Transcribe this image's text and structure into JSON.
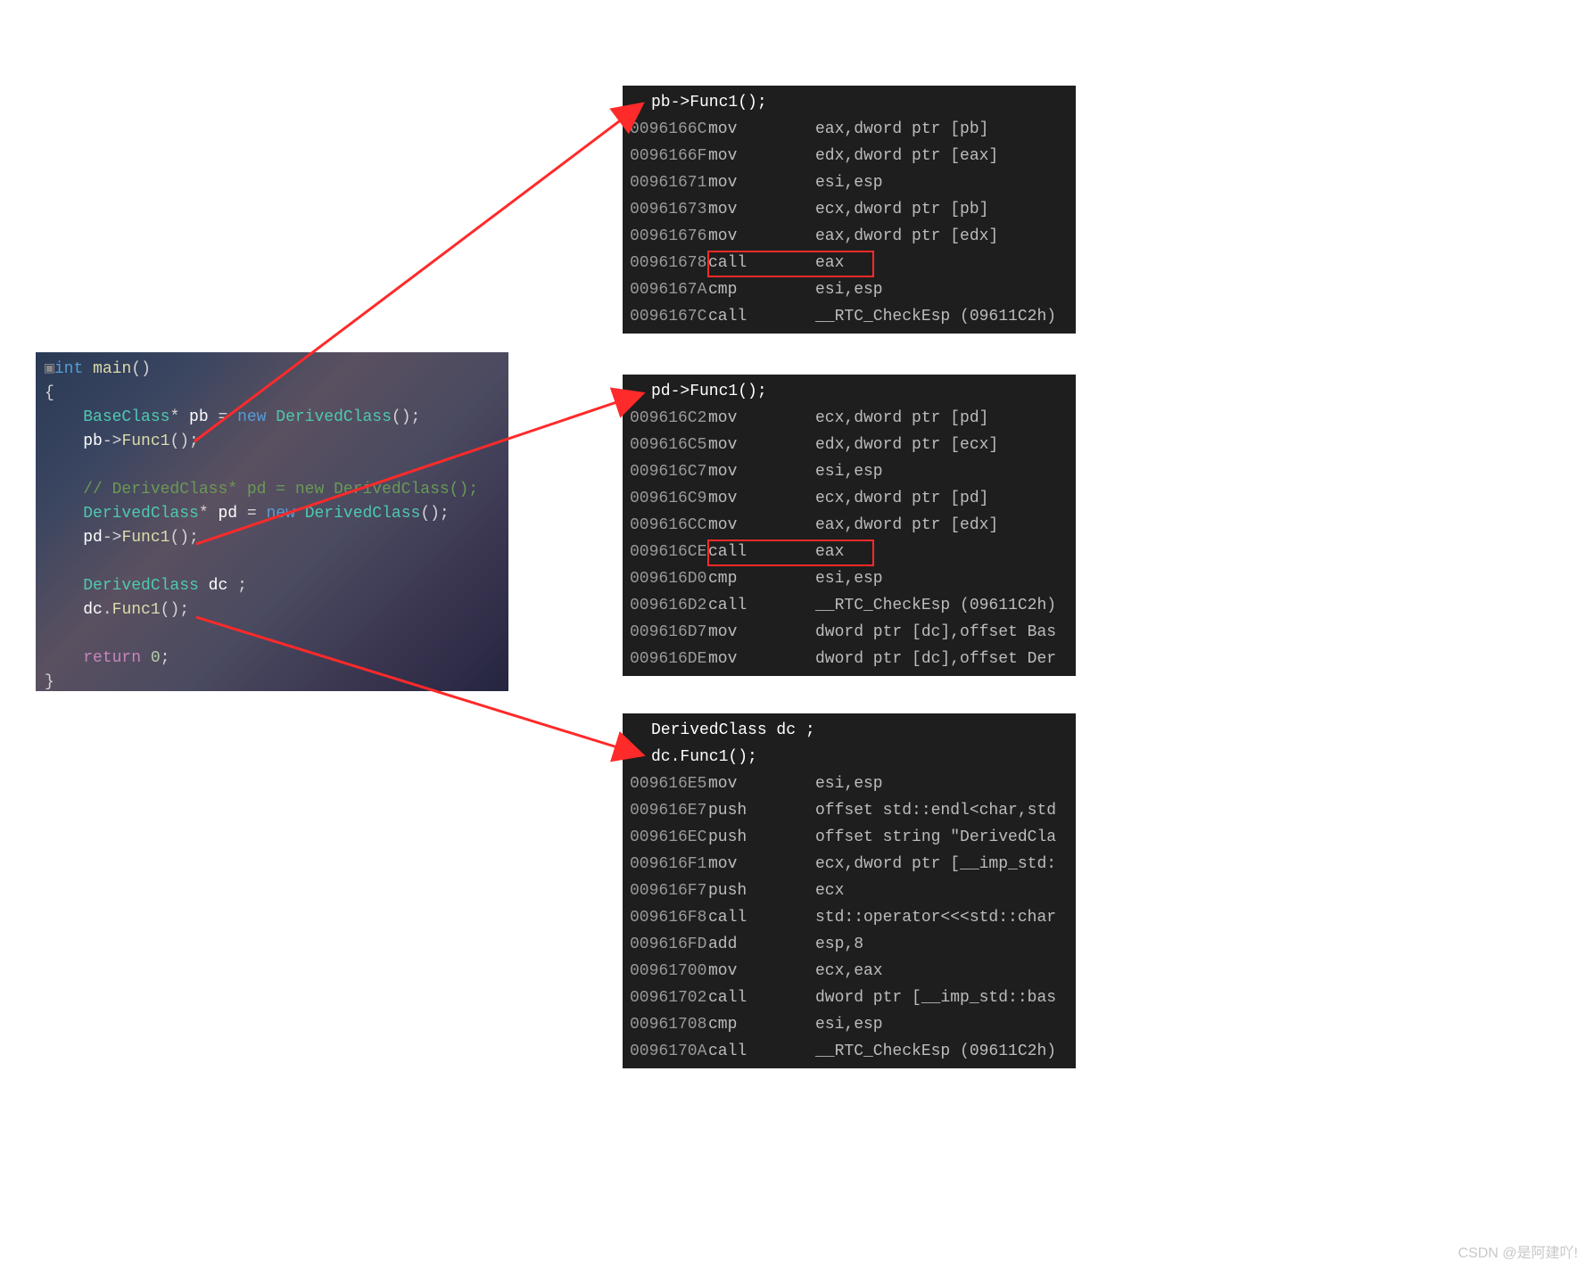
{
  "source": {
    "fn_sig_type": "int",
    "fn_sig_name": "main",
    "line_base_decl_a": "BaseClass",
    "line_base_decl_b": "pb",
    "line_base_decl_c": "new",
    "line_base_decl_d": "DerivedClass",
    "line_pb_call_obj": "pb",
    "line_pb_call_fn": "Func1",
    "line_cmt": "// DerivedClass* pd = new DerivedClass();",
    "line_pd_decl_a": "DerivedClass",
    "line_pd_decl_b": "pd",
    "line_pd_decl_c": "new",
    "line_pd_decl_d": "DerivedClass",
    "line_pd_call_obj": "pd",
    "line_pd_call_fn": "Func1",
    "line_dc_decl_a": "DerivedClass",
    "line_dc_decl_b": "dc",
    "line_dc_call_obj": "dc",
    "line_dc_call_fn": "Func1",
    "line_ret_kw": "return",
    "line_ret_val": "0"
  },
  "asm1": {
    "header": "pb->Func1();",
    "rows": [
      {
        "addr": "0096166C",
        "mnem": "mov",
        "oper": "eax,dword ptr [pb]"
      },
      {
        "addr": "0096166F",
        "mnem": "mov",
        "oper": "edx,dword ptr [eax]"
      },
      {
        "addr": "00961671",
        "mnem": "mov",
        "oper": "esi,esp"
      },
      {
        "addr": "00961673",
        "mnem": "mov",
        "oper": "ecx,dword ptr [pb]"
      },
      {
        "addr": "00961676",
        "mnem": "mov",
        "oper": "eax,dword ptr [edx]"
      },
      {
        "addr": "00961678",
        "mnem": "call",
        "oper": "eax"
      },
      {
        "addr": "0096167A",
        "mnem": "cmp",
        "oper": "esi,esp"
      },
      {
        "addr": "0096167C",
        "mnem": "call",
        "oper": "__RTC_CheckEsp (09611C2h)"
      }
    ]
  },
  "asm2": {
    "header": "pd->Func1();",
    "rows": [
      {
        "addr": "009616C2",
        "mnem": "mov",
        "oper": "ecx,dword ptr [pd]"
      },
      {
        "addr": "009616C5",
        "mnem": "mov",
        "oper": "edx,dword ptr [ecx]"
      },
      {
        "addr": "009616C7",
        "mnem": "mov",
        "oper": "esi,esp"
      },
      {
        "addr": "009616C9",
        "mnem": "mov",
        "oper": "ecx,dword ptr [pd]"
      },
      {
        "addr": "009616CC",
        "mnem": "mov",
        "oper": "eax,dword ptr [edx]"
      },
      {
        "addr": "009616CE",
        "mnem": "call",
        "oper": "eax"
      },
      {
        "addr": "009616D0",
        "mnem": "cmp",
        "oper": "esi,esp"
      },
      {
        "addr": "009616D2",
        "mnem": "call",
        "oper": "__RTC_CheckEsp (09611C2h)"
      },
      {
        "addr": "009616D7",
        "mnem": "mov",
        "oper": "dword ptr [dc],offset Bas"
      },
      {
        "addr": "009616DE",
        "mnem": "mov",
        "oper": "dword ptr [dc],offset Der"
      }
    ]
  },
  "asm3": {
    "header1": "DerivedClass dc ;",
    "header2": "dc.Func1();",
    "rows": [
      {
        "addr": "009616E5",
        "mnem": "mov",
        "oper": "esi,esp"
      },
      {
        "addr": "009616E7",
        "mnem": "push",
        "oper": "offset std::endl<char,std"
      },
      {
        "addr": "009616EC",
        "mnem": "push",
        "oper": "offset string \"DerivedCla"
      },
      {
        "addr": "009616F1",
        "mnem": "mov",
        "oper": "ecx,dword ptr [__imp_std:"
      },
      {
        "addr": "009616F7",
        "mnem": "push",
        "oper": "ecx"
      },
      {
        "addr": "009616F8",
        "mnem": "call",
        "oper": "std::operator<<<std::char"
      },
      {
        "addr": "009616FD",
        "mnem": "add",
        "oper": "esp,8"
      },
      {
        "addr": "00961700",
        "mnem": "mov",
        "oper": "ecx,eax"
      },
      {
        "addr": "00961702",
        "mnem": "call",
        "oper": "dword ptr [__imp_std::bas"
      },
      {
        "addr": "00961708",
        "mnem": "cmp",
        "oper": "esi,esp"
      },
      {
        "addr": "0096170A",
        "mnem": "call",
        "oper": "__RTC_CheckEsp (09611C2h)"
      }
    ]
  },
  "watermark": "CSDN @是阿建吖!"
}
